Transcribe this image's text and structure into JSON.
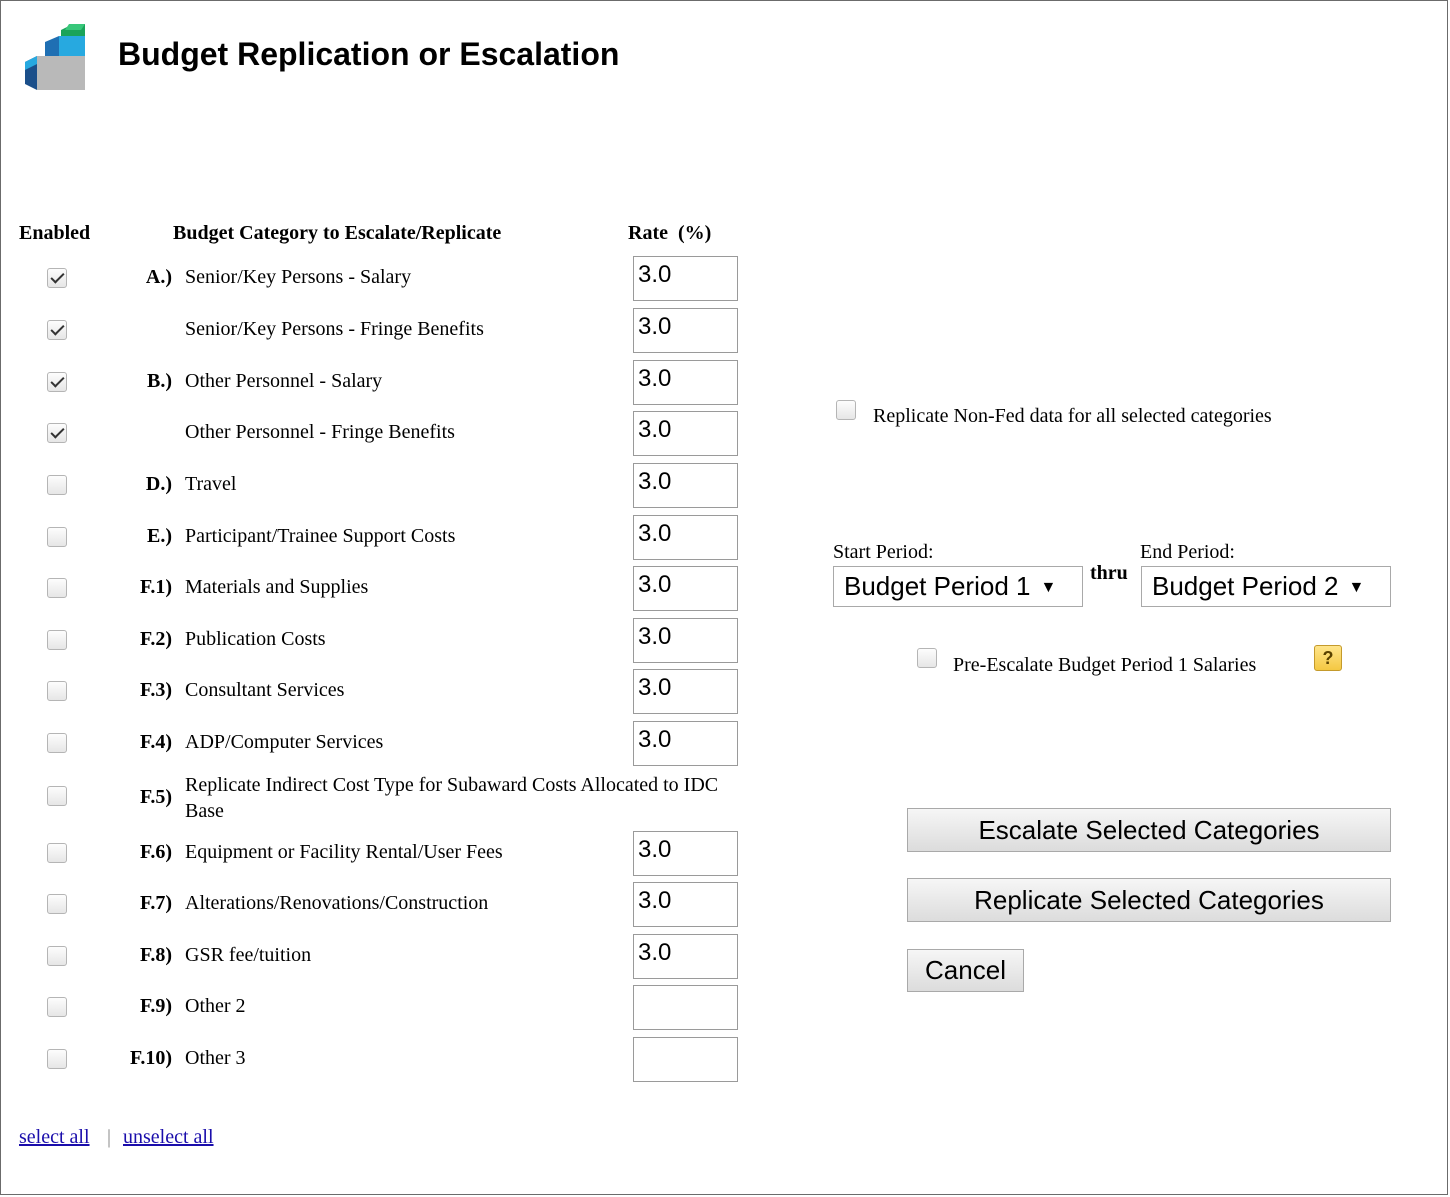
{
  "page": {
    "title": "Budget Replication or Escalation",
    "logo_icon": "stairs-logo-icon"
  },
  "table": {
    "headers": {
      "enabled": "Enabled",
      "category": "Budget Category to Escalate/Replicate",
      "rate": "Rate  (%)"
    },
    "rows": [
      {
        "code": "A.)",
        "label": "Senior/Key Persons - Salary",
        "checked": true,
        "rate": "3.0"
      },
      {
        "code": "",
        "label": "Senior/Key Persons - Fringe Benefits",
        "checked": true,
        "rate": "3.0"
      },
      {
        "code": "B.)",
        "label": "Other Personnel - Salary",
        "checked": true,
        "rate": "3.0"
      },
      {
        "code": "",
        "label": "Other Personnel - Fringe Benefits",
        "checked": true,
        "rate": "3.0"
      },
      {
        "code": "D.)",
        "label": "Travel",
        "checked": false,
        "rate": "3.0"
      },
      {
        "code": "E.)",
        "label": "Participant/Trainee Support Costs",
        "checked": false,
        "rate": "3.0"
      },
      {
        "code": "F.1)",
        "label": "Materials and Supplies",
        "checked": false,
        "rate": "3.0"
      },
      {
        "code": "F.2)",
        "label": "Publication Costs",
        "checked": false,
        "rate": "3.0"
      },
      {
        "code": "F.3)",
        "label": "Consultant Services",
        "checked": false,
        "rate": "3.0"
      },
      {
        "code": "F.4)",
        "label": "ADP/Computer Services",
        "checked": false,
        "rate": "3.0"
      },
      {
        "code": "F.5)",
        "label": "Replicate Indirect Cost Type for Subaward Costs Allocated to IDC Base",
        "checked": false,
        "rate": null
      },
      {
        "code": "F.6)",
        "label": "Equipment or Facility Rental/User Fees",
        "checked": false,
        "rate": "3.0"
      },
      {
        "code": "F.7)",
        "label": "Alterations/Renovations/Construction",
        "checked": false,
        "rate": "3.0"
      },
      {
        "code": "F.8)",
        "label": "GSR fee/tuition",
        "checked": false,
        "rate": "3.0"
      },
      {
        "code": "F.9)",
        "label": "Other 2",
        "checked": false,
        "rate": ""
      },
      {
        "code": "F.10)",
        "label": "Other 3",
        "checked": false,
        "rate": ""
      }
    ]
  },
  "options": {
    "replicate_nonfed": {
      "label": "Replicate Non-Fed data for all selected categories",
      "checked": false
    },
    "start_period": {
      "label": "Start Period:",
      "value": "Budget Period 1"
    },
    "thru": "thru",
    "end_period": {
      "label": "End Period:",
      "value": "Budget Period 2"
    },
    "pre_escalate": {
      "label": "Pre-Escalate Budget Period 1 Salaries",
      "checked": false,
      "help": "?"
    }
  },
  "buttons": {
    "escalate": "Escalate Selected Categories",
    "replicate": "Replicate Selected Categories",
    "cancel": "Cancel"
  },
  "links": {
    "select_all": "select all",
    "separator": "|",
    "unselect_all": "unselect all"
  }
}
